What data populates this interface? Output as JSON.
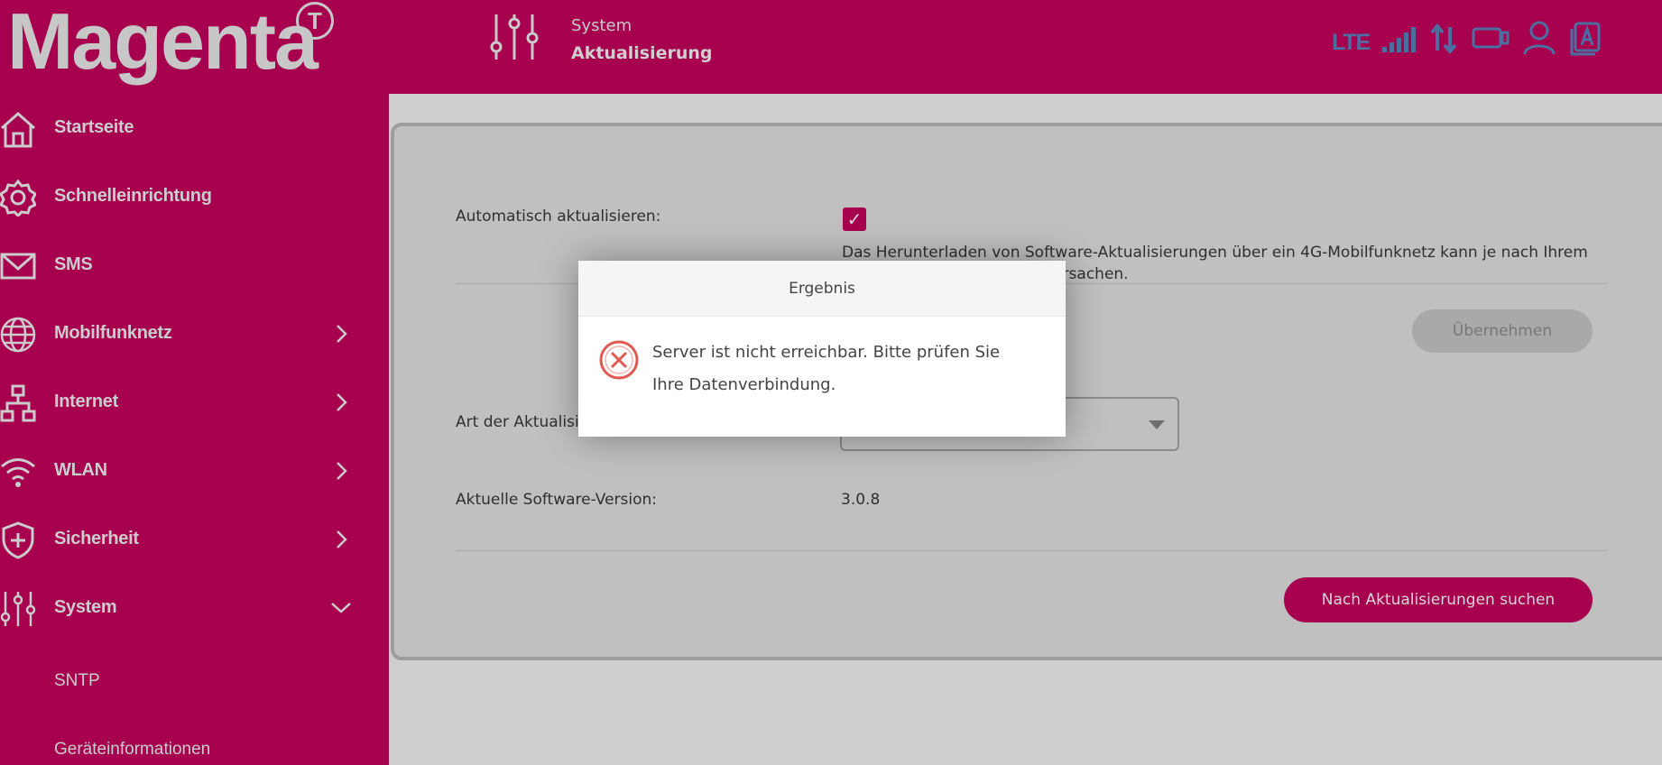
{
  "header": {
    "logo_text": "Magenta",
    "logo_mark": "T",
    "breadcrumb_section": "System",
    "page_title": "Aktualisierung",
    "section_icon": "sliders-icon",
    "status_icons": {
      "network_type": "LTE",
      "signal": "signal-bars-icon",
      "data": "data-transfer-icon",
      "device": "device-icon",
      "user": "user-icon",
      "language": "language-icon"
    }
  },
  "sidebar": {
    "items": [
      {
        "label": "Startseite",
        "icon": "home-icon",
        "chevron": "none"
      },
      {
        "label": "Schnelleinrichtung",
        "icon": "gear-icon",
        "chevron": "none"
      },
      {
        "label": "SMS",
        "icon": "envelope-icon",
        "chevron": "none"
      },
      {
        "label": "Mobilfunknetz",
        "icon": "globe-icon",
        "chevron": "right"
      },
      {
        "label": "Internet",
        "icon": "network-icon",
        "chevron": "right"
      },
      {
        "label": "WLAN",
        "icon": "wifi-icon",
        "chevron": "right"
      },
      {
        "label": "Sicherheit",
        "icon": "shield-icon",
        "chevron": "right"
      },
      {
        "label": "System",
        "icon": "sliders-icon",
        "chevron": "down"
      }
    ],
    "sub_items": [
      {
        "label": "SNTP"
      },
      {
        "label": "Geräteinformationen"
      }
    ]
  },
  "content": {
    "auto_update_label": "Automatisch aktualisieren:",
    "auto_update_checked": true,
    "auto_update_note": "Das Herunterladen von Software-Aktualisierungen über ein 4G-Mobilfunknetz kann je nach Ihrem Vertrag Datengebühren verursachen.",
    "apply_button": "Übernehmen",
    "update_type_label": "Art der Aktualisierung:",
    "update_type_value": "",
    "version_label": "Aktuelle Software-Version:",
    "version_value": "3.0.8",
    "search_button": "Nach Aktualisierungen suchen"
  },
  "modal": {
    "title": "Ergebnis",
    "icon": "error-icon",
    "message": "Server ist nicht erreichbar. Bitte prüfen Sie Ihre Datenverbindung."
  },
  "colors": {
    "brand": "#a6004f",
    "sidebar_text": "#cccccc",
    "status_icon": "#4d6ea0",
    "error": "#e05a52"
  }
}
